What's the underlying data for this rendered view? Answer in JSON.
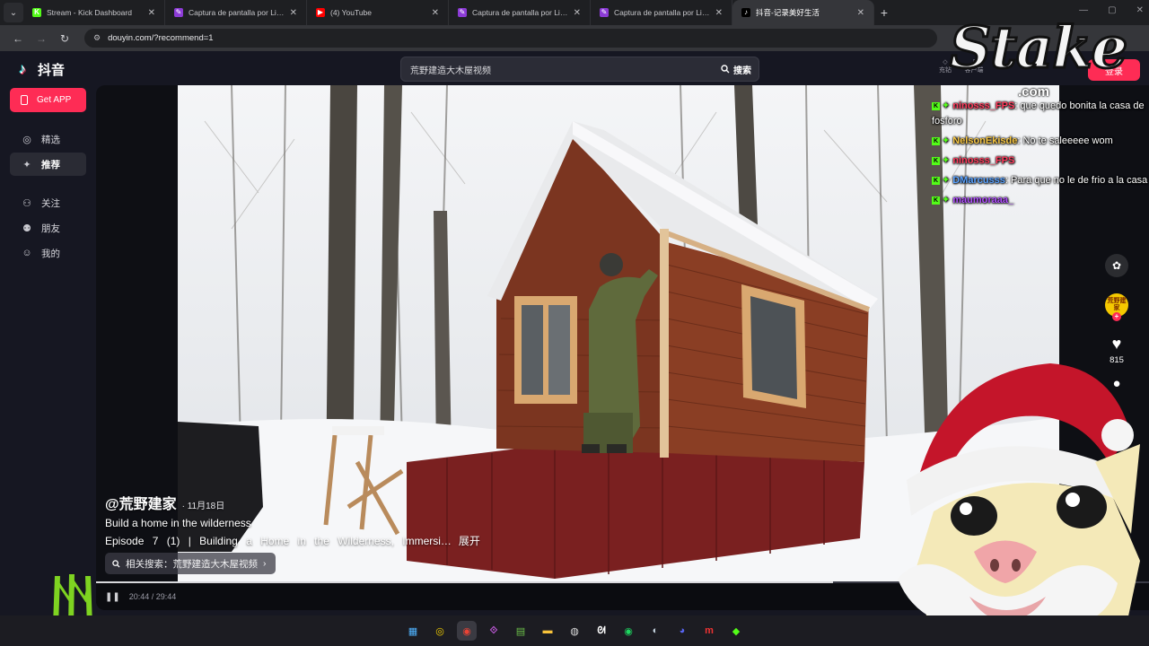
{
  "browser": {
    "tabs": [
      {
        "title": "Stream - Kick Dashboard",
        "icon": "kick-icon",
        "color": "#53fc18",
        "glyph": "K"
      },
      {
        "title": "Captura de pantalla por Lightsh",
        "icon": "lightshot-icon",
        "color": "#8c3bd6",
        "glyph": "✎"
      },
      {
        "title": "(4) YouTube",
        "icon": "youtube-icon",
        "color": "#ff0000",
        "glyph": "▶"
      },
      {
        "title": "Captura de pantalla por Lightsh",
        "icon": "lightshot-icon",
        "color": "#8c3bd6",
        "glyph": "✎"
      },
      {
        "title": "Captura de pantalla por Lightsh",
        "icon": "lightshot-icon",
        "color": "#8c3bd6",
        "glyph": "✎"
      },
      {
        "title": "抖音-记录美好生活",
        "icon": "douyin-icon",
        "color": "#000000",
        "glyph": "♪"
      }
    ],
    "url": "douyin.com/?recommend=1"
  },
  "douyin": {
    "logo_text": "抖音",
    "search_placeholder": "荒野建造大木屋视频",
    "search_button": "搜索",
    "login_button": "登录",
    "top_icons": [
      "充钻",
      "客户端"
    ],
    "get_app": "Get APP",
    "sidebar": [
      {
        "label": "精选",
        "icon": "compass-icon",
        "glyph": "◎"
      },
      {
        "label": "推荐",
        "icon": "sparkle-icon",
        "glyph": "✦",
        "active": true
      },
      {
        "label": "关注",
        "icon": "follow-icon",
        "glyph": "⚇"
      },
      {
        "label": "朋友",
        "icon": "friends-icon",
        "glyph": "⚉"
      },
      {
        "label": "我的",
        "icon": "profile-icon",
        "glyph": "☺"
      }
    ]
  },
  "video": {
    "author": "@荒野建家",
    "date": "· 11月18日",
    "desc_line1": "Build a home in the wilderness",
    "desc_line2": "Episode 7 (1) | Building a Home in the Wilderness, Immersi…",
    "expand": "展开",
    "related_prefix": "相关搜索：",
    "related_query": "荒野建造大木屋视频",
    "time": "20:44 / 29:44",
    "progress": 0.7,
    "likes": "815",
    "avatar_text": "荒野建家"
  },
  "chat": [
    {
      "user": "ninosss_FPS",
      "color": "#ff3b5c",
      "message": ": que quedo bonita la casa de fosforo"
    },
    {
      "user": "NelsonEkisde",
      "color": "#f5c542",
      "message": ": No te saleeeee wom"
    },
    {
      "user": "ninosss_FPS",
      "color": "#ff3b5c",
      "message": ""
    },
    {
      "user": "DMarcusss",
      "color": "#5aa2ff",
      "message": ": Para que no le de frio a la casa"
    },
    {
      "user": "maumoraaa_",
      "color": "#b04cff",
      "message": ""
    }
  ],
  "overlays": {
    "stake_word": "Stake",
    "stake_com": ".com"
  }
}
